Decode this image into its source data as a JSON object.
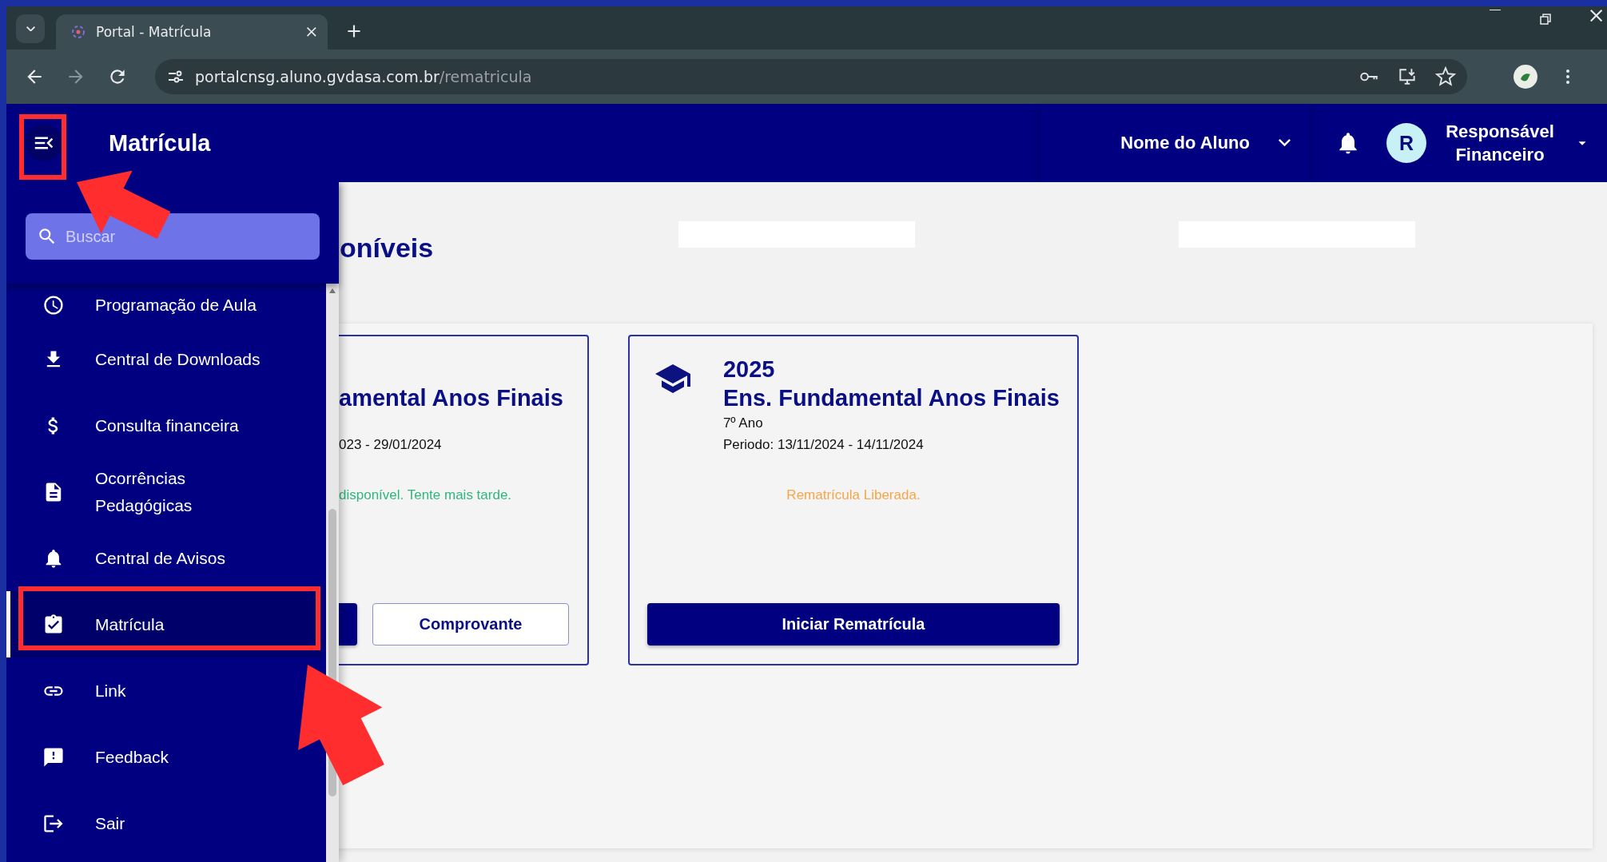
{
  "browser": {
    "tab_title": "Portal - Matrícula",
    "url_host": "portalcnsg.aluno.gvdasa.com.br",
    "url_path": "/rematricula"
  },
  "header": {
    "title": "Matrícula",
    "student": "Nome do Aluno",
    "avatar_initial": "R",
    "user_role": "Responsável Financeiro"
  },
  "sidebar": {
    "search_placeholder": "Buscar",
    "items": [
      {
        "label": "Programação de Aula",
        "selected": false
      },
      {
        "label": "Central de Downloads",
        "selected": false
      },
      {
        "label": "Consulta financeira",
        "selected": false
      },
      {
        "label": "Ocorrências Pedagógicas",
        "selected": false
      },
      {
        "label": "Central de Avisos",
        "selected": false
      },
      {
        "label": "Matrícula",
        "selected": true
      },
      {
        "label": "Link",
        "selected": false
      },
      {
        "label": "Feedback",
        "selected": false
      },
      {
        "label": "Sair",
        "selected": false
      }
    ]
  },
  "page": {
    "heading": "oníveis",
    "cards": [
      {
        "clipped": true,
        "title": "amental Anos Finais",
        "period": "023 - 29/01/2024",
        "status": {
          "text": "disponível. Tente mais tarde.",
          "color": "#2fb67c"
        },
        "buttons": [
          {
            "kind": "primary"
          },
          {
            "kind": "outline",
            "label": "Comprovante"
          }
        ]
      },
      {
        "clipped": false,
        "year": "2025",
        "title": "Ens. Fundamental Anos Finais",
        "grade": "7º Ano",
        "period": "Periodo: 13/11/2024 - 14/11/2024",
        "status": {
          "text": "Rematrícula Liberada.",
          "color": "#f7a548"
        },
        "buttons": [
          {
            "kind": "primary",
            "label": "Iniciar Rematrícula"
          }
        ]
      }
    ]
  }
}
